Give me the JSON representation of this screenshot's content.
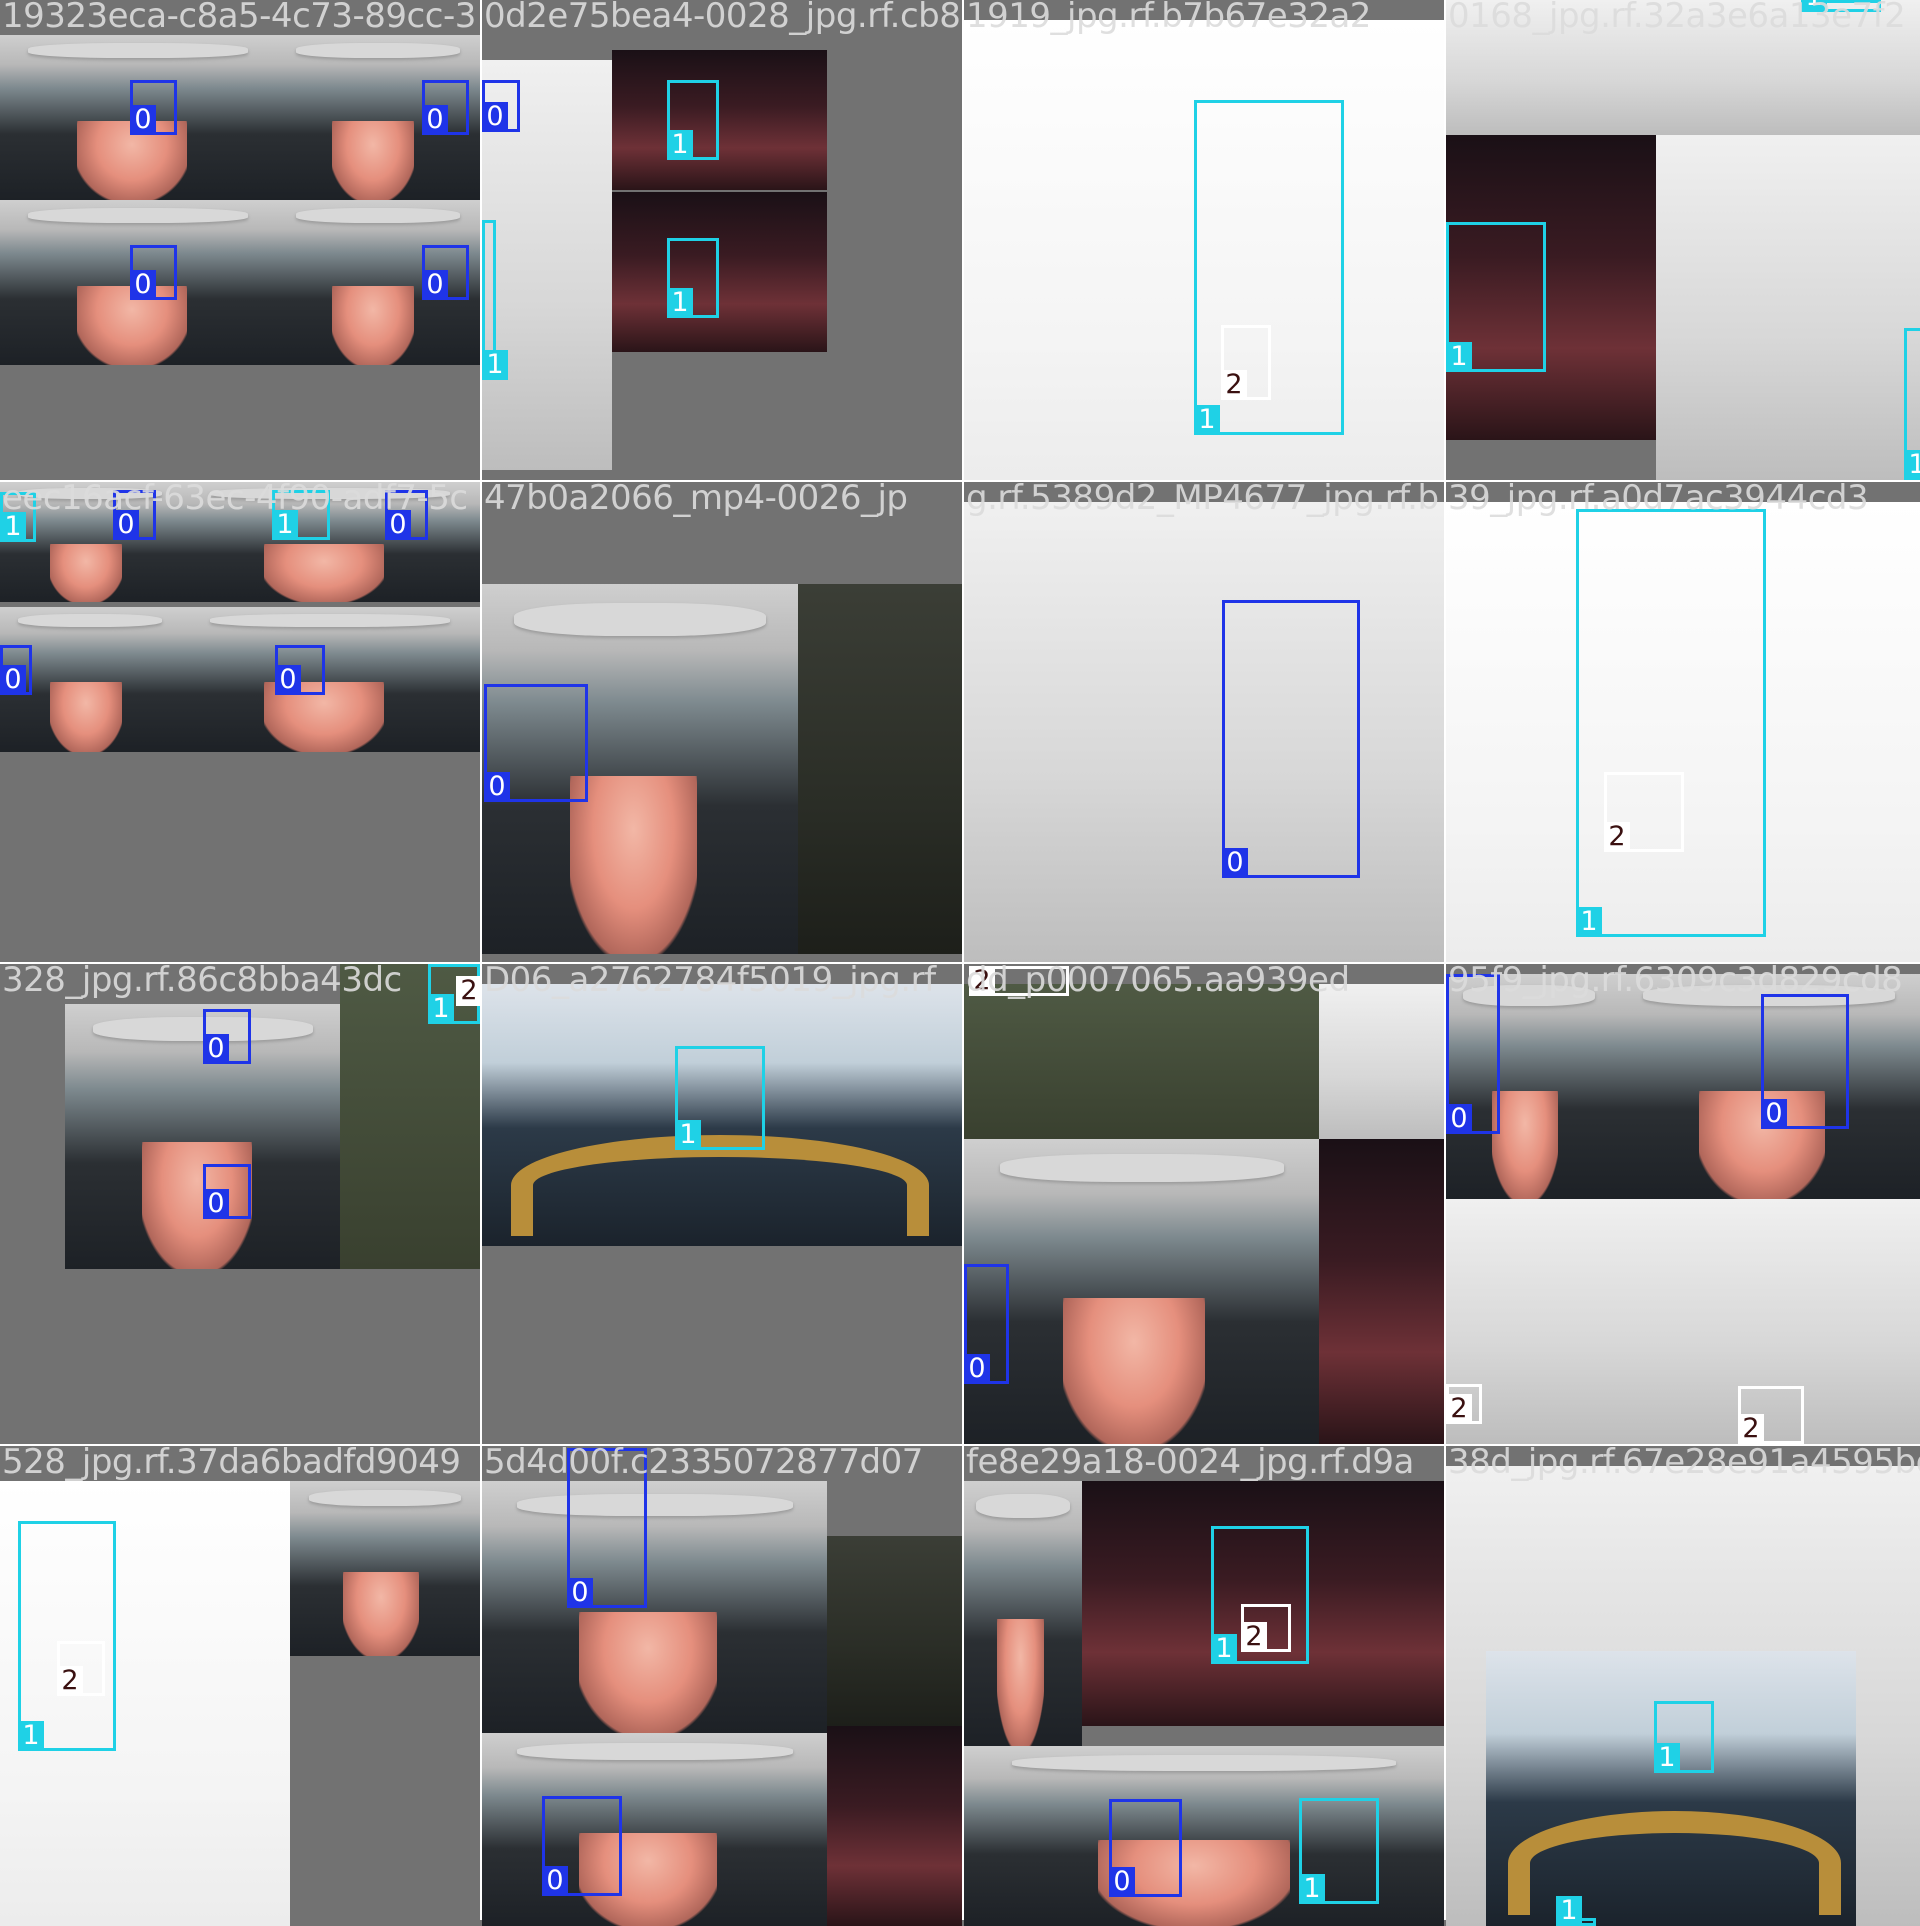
{
  "colors": {
    "class0": "#1f34e8",
    "class1": "#1fd1e6",
    "class2": "#ffffff",
    "pad": "#727272"
  },
  "class_labels": [
    "0",
    "1",
    "2"
  ],
  "titles": [
    "19323eca-c8a5-4c73-89cc-3",
    "0d2e75bea4-0028_jpg.rf.cb8",
    "1919_jpg.rf.b7b67e32a2",
    "0168_jpg.rf.32a3e6a13e7f2",
    "eec16acf-63ec-4f90-adf7-5c",
    "47b0a2066_mp4-0026_jp",
    "g.rf.5389d2_MP4677_jpg.rf.b",
    "39_jpg.rf.a0d7ac3944cd3",
    "328_jpg.rf.86c8bba43dc",
    "D06_a2762784f5019_jpg.rf",
    "dd_p0007065.aa939ed",
    "95f9_jpg.rf.6309c3d829cd8",
    "528_jpg.rf.37da6badfd9049",
    "5d4d00f.c2335072877d07",
    "fe8e29a18-0024_jpg.rf.d9a",
    "38d_jpg.rf.67e28e91a4595bc"
  ]
}
